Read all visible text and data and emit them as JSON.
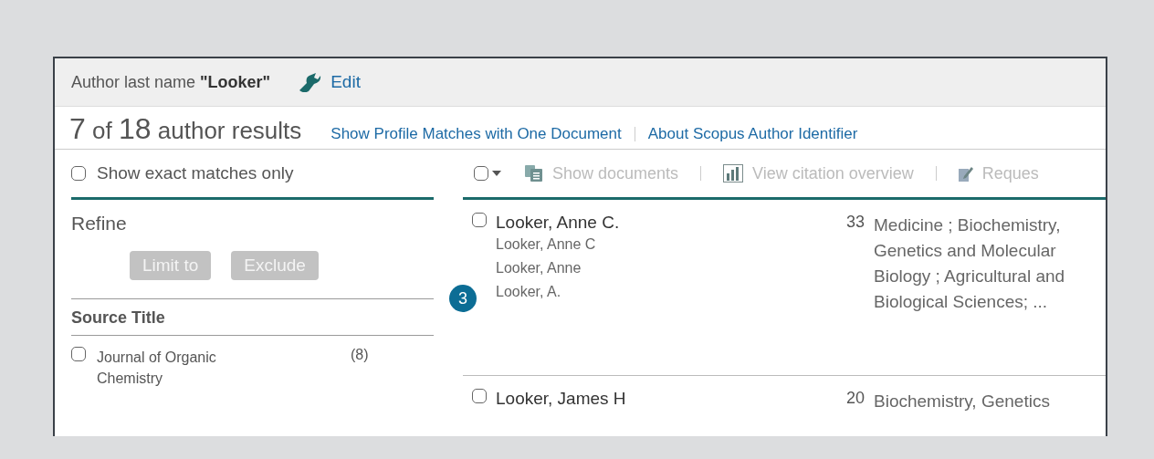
{
  "search_bar": {
    "label": "Author last name **\"Looker\"**",
    "edit": "Edit"
  },
  "results_header": {
    "shown": "7",
    "of": "of",
    "total": "18",
    "label": "author results",
    "links": [
      "Show Profile Matches with One Document",
      "About Scopus Author Identifier"
    ]
  },
  "exact_match": {
    "label": "Show exact matches only",
    "checked": false
  },
  "refine": {
    "title": "Refine",
    "buttons": [
      {
        "label": "Limit to",
        "disabled": true
      },
      {
        "label": "Exclude",
        "disabled": true
      }
    ]
  },
  "source_title": {
    "title": "Source Title",
    "items": [
      {
        "label": "Journal of Organic Chemistry",
        "count": "(8)",
        "checked": false
      }
    ]
  },
  "toolbar": {
    "select_all_checked": false,
    "actions": [
      {
        "label": "Show documents",
        "kind": "documents",
        "disabled": true
      },
      {
        "label": "View citation overview",
        "kind": "chart",
        "disabled": true
      },
      {
        "label": "Reques",
        "kind": "pencil",
        "disabled": true
      }
    ]
  },
  "results": [
    {
      "name": "Looker, Anne C.",
      "variants": [
        "Looker, Anne C",
        "Looker, Anne",
        "Looker, A."
      ],
      "documents": "33",
      "subjects": "Medicine ; Biochemistry, Genetics and Molecular Biology ; Agricultural and Biological Sciences; ...",
      "checked": false
    },
    {
      "name": "Looker, James H",
      "documents": "20",
      "subjects": "Biochemistry, Genetics",
      "checked": false
    }
  ],
  "badge": {
    "text": "3"
  }
}
